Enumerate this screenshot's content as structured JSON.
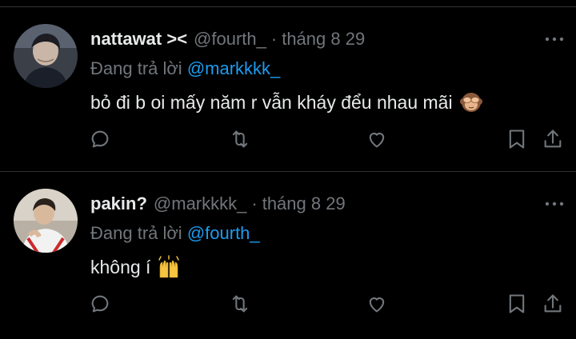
{
  "colors": {
    "background": "#000000",
    "text_primary": "#e7e9ea",
    "text_secondary": "#71767b",
    "accent": "#1d9bf0",
    "divider": "#2f3336"
  },
  "tweets": [
    {
      "display_name": "nattawat ><",
      "handle": "@fourth_",
      "separator": "·",
      "date": "tháng 8 29",
      "reply_prefix": "Đang trả lời",
      "reply_to": "@markkkk_",
      "text": "bỏ đi b oi mấy năm r vẫn kháy đểu nhau mãi",
      "emoji": "see-no-evil-monkey",
      "avatar": "avatar-nattawat",
      "actions": [
        "reply-icon",
        "retweet-icon",
        "like-icon",
        "bookmark-icon",
        "share-icon"
      ]
    },
    {
      "display_name": "pakin?",
      "handle": "@markkkk_",
      "separator": "·",
      "date": "tháng 8 29",
      "reply_prefix": "Đang trả lời",
      "reply_to": "@fourth_",
      "text": "không í",
      "emoji": "raising-hands",
      "avatar": "avatar-pakin",
      "actions": [
        "reply-icon",
        "retweet-icon",
        "like-icon",
        "bookmark-icon",
        "share-icon"
      ]
    }
  ]
}
